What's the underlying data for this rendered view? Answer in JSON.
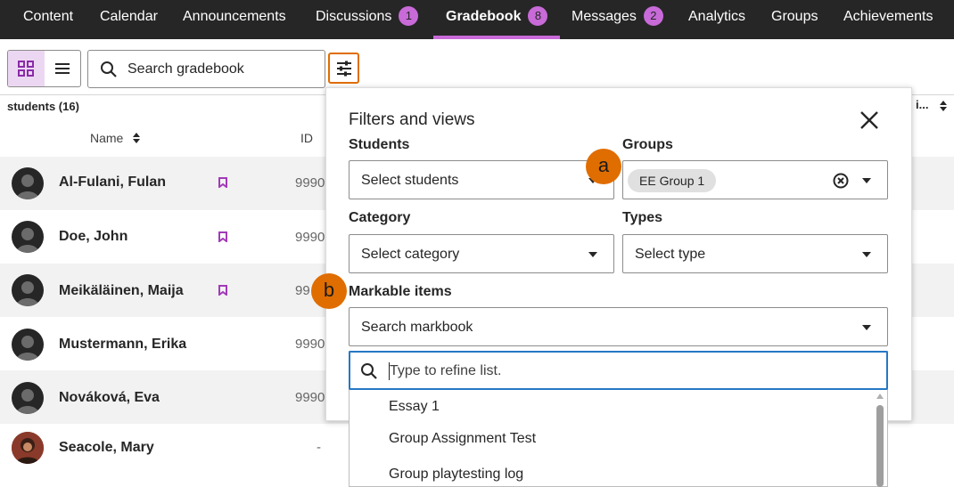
{
  "nav": {
    "items": [
      {
        "label": "Content",
        "badge": null
      },
      {
        "label": "Calendar",
        "badge": null
      },
      {
        "label": "Announcements",
        "badge": null
      },
      {
        "label": "Discussions",
        "badge": "1"
      },
      {
        "label": "Gradebook",
        "badge": "8"
      },
      {
        "label": "Messages",
        "badge": "2"
      },
      {
        "label": "Analytics",
        "badge": null
      },
      {
        "label": "Groups",
        "badge": null
      },
      {
        "label": "Achievements",
        "badge": null
      }
    ],
    "active": "Gradebook"
  },
  "toolbar": {
    "search_placeholder": "Search gradebook"
  },
  "table": {
    "count_label": "students (16)",
    "col_name": "Name",
    "col_id": "ID",
    "right_truncated": "i...",
    "rows": [
      {
        "name": "Al-Fulani, Fulan",
        "id": "9990",
        "flag": true
      },
      {
        "name": "Doe, John",
        "id": "9990",
        "flag": true
      },
      {
        "name": "Meikäläinen, Maija",
        "id": "99",
        "flag": true
      },
      {
        "name": "Mustermann, Erika",
        "id": "9990",
        "flag": false
      },
      {
        "name": "Nováková, Eva",
        "id": "9990",
        "flag": false
      },
      {
        "name": "Seacole, Mary",
        "id": "-",
        "flag": false
      }
    ]
  },
  "filters": {
    "title": "Filters and views",
    "students_label": "Students",
    "students_placeholder": "Select students",
    "groups_label": "Groups",
    "groups_chip": "EE Group 1",
    "category_label": "Category",
    "category_placeholder": "Select category",
    "types_label": "Types",
    "types_placeholder": "Select type",
    "markable_label": "Markable items",
    "markable_placeholder": "Search markbook",
    "refine_placeholder": "Type to refine list.",
    "items": [
      "Essay 1",
      "Group Assignment Test",
      "Group playtesting log"
    ]
  },
  "markers": {
    "a": "a",
    "b": "b"
  },
  "colors": {
    "accent": "#c86ad8",
    "highlight": "#e06d00",
    "focus": "#2578c4",
    "nav_bg": "#262626"
  }
}
